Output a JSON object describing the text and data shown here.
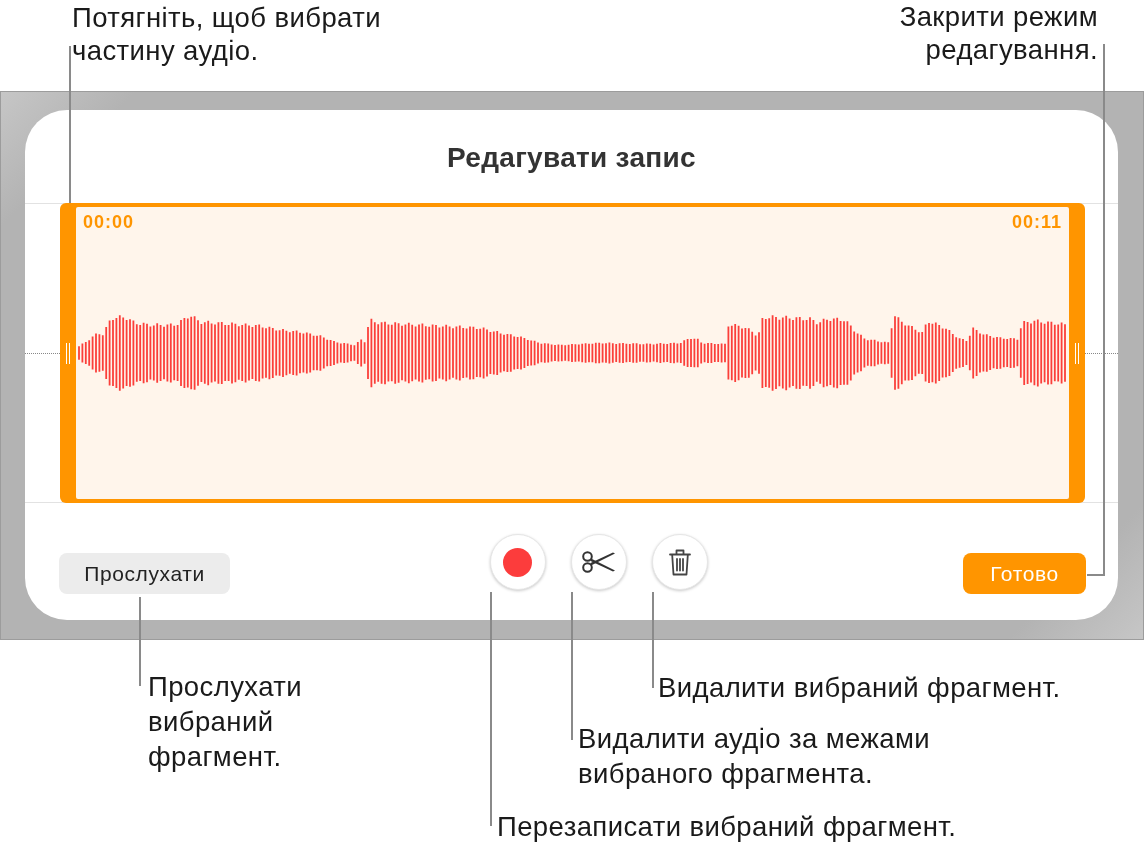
{
  "callouts": [
    {
      "text": "Потягніть, щоб вибрати\nчастину аудіо."
    },
    {
      "text": "Закрити режим\nредагування."
    },
    {
      "text": "Прослухати\nвибраний\nфрагмент."
    },
    {
      "text": "Видалити вибраний фрагмент."
    },
    {
      "text": "Видалити аудіо за межами\nвибраного фрагмента."
    },
    {
      "text": "Перезаписати вибраний фрагмент."
    }
  ],
  "dialog": {
    "title": "Редагувати запис",
    "selection": {
      "start_time": "00:00",
      "end_time": "00:11"
    },
    "play_button": {
      "label": "Прослухати"
    },
    "tools": [
      {
        "kind": "record"
      },
      {
        "kind": "trim"
      },
      {
        "kind": "delete"
      }
    ],
    "done_button": {
      "label": "Готово"
    }
  }
}
